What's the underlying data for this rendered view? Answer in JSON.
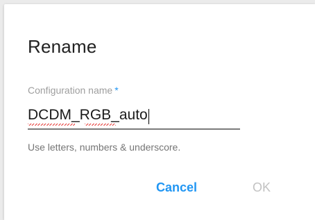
{
  "dialog": {
    "title": "Rename",
    "field": {
      "label": "Configuration name",
      "required_marker": "*",
      "value": "DCDM_RGB_auto",
      "helper": "Use letters, numbers & underscore."
    },
    "buttons": {
      "cancel_label": "Cancel",
      "ok_label": "OK"
    }
  },
  "colors": {
    "accent": "#2196f3",
    "disabled": "#c2c2c2",
    "spellcheck": "#e53935"
  }
}
